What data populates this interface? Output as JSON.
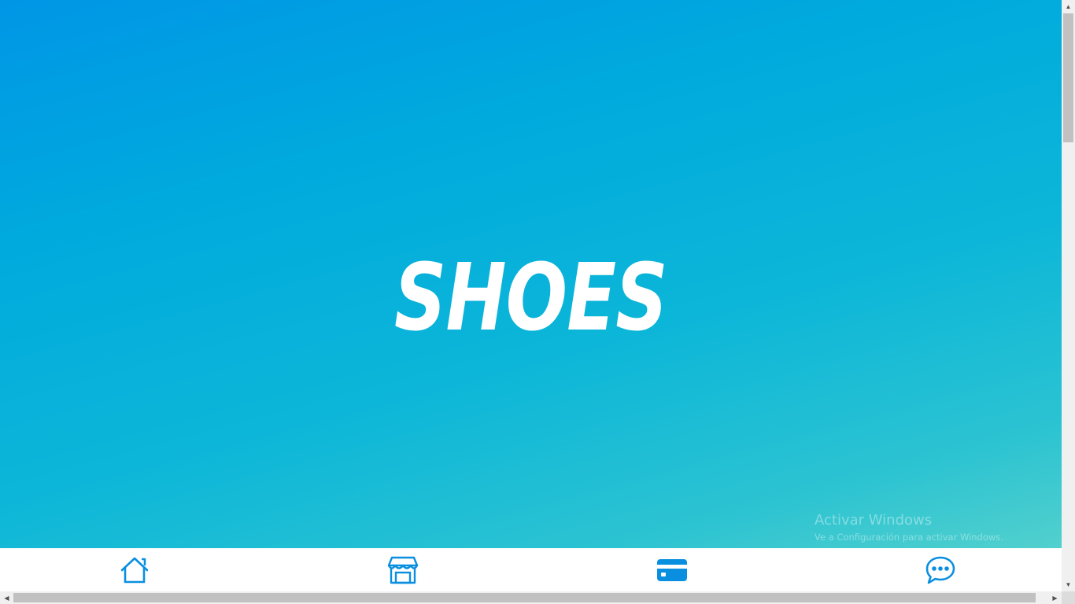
{
  "hero": {
    "title": "SHOES"
  },
  "watermark": {
    "title": "Activar Windows",
    "subtitle": "Ve a Configuración para activar Windows."
  },
  "bottom_nav": {
    "items": [
      {
        "name": "home",
        "icon": "home-icon"
      },
      {
        "name": "store",
        "icon": "store-icon"
      },
      {
        "name": "payment",
        "icon": "credit-card-icon"
      },
      {
        "name": "chat",
        "icon": "chat-icon"
      }
    ]
  },
  "colors": {
    "accent": "#0a8fe0",
    "hero_top": "#0096e6",
    "hero_bottom": "#52d0cd",
    "title": "#ffffff"
  },
  "scrollbars": {
    "arrow_up": "▲",
    "arrow_down": "▼",
    "arrow_left": "◀",
    "arrow_right": "▶"
  }
}
